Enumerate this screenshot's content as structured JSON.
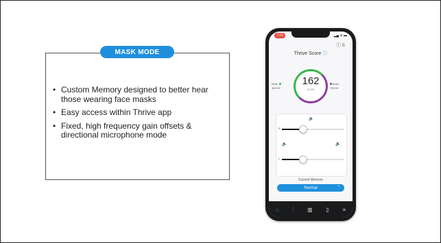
{
  "slide": {
    "pill_label": "MASK MODE",
    "bullets": [
      "Custom Memory designed to better hear those wearing face masks",
      "Easy access within Thrive app",
      "Fixed, high frequency gain offsets & directional microphone mode"
    ],
    "bullet_char": "•"
  },
  "phone": {
    "time": "7:20",
    "status_text": "▂▄ ≋ ▬",
    "help_text": "ⓘ il.",
    "title": "Thrive Score",
    "title_icon": "ⓘ",
    "score": "162",
    "score_sub": "of 200",
    "body_label": "Body",
    "body_value": "48/100",
    "brain_label": "Brain",
    "brain_value": "78/100",
    "volume_left_label": "R",
    "volume_right_label": "L",
    "volume_level_top": 0.33,
    "volume_level_bottom": 0.33,
    "current_memory_label": "Current Memory",
    "memory_value": "Normal",
    "colors": {
      "accent": "#1f8fdc",
      "green": "#3ab54a",
      "purple": "#8c3fa0",
      "badge": "#e84a3f"
    }
  }
}
